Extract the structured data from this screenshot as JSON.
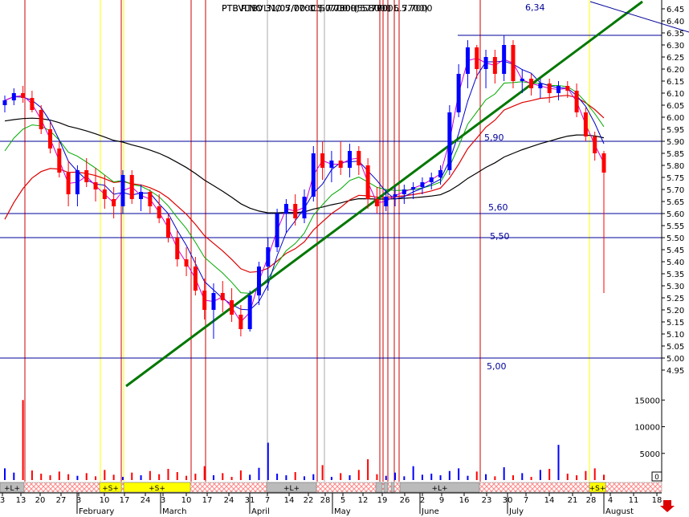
{
  "header": {
    "title": "PTBVLNO 31/07/00: C 5.7700 (5.7700, 5.7700)",
    "overprint_1": "PTBVLNO 31/07/00 C 5.7700 H 5.8000 L 5.7000",
    "overprint_2": "PTBVLNO 5.7700 (-0.0300) 5.7700"
  },
  "price_ticks": [
    "6.45",
    "6.40",
    "6.35",
    "6.30",
    "6.25",
    "6.20",
    "6.15",
    "6.10",
    "6.05",
    "6.00",
    "5.95",
    "5.90",
    "5.85",
    "5.80",
    "5.75",
    "5.70",
    "5.65",
    "5.60",
    "5.55",
    "5.50",
    "5.45",
    "5.40",
    "5.35",
    "5.30",
    "5.25",
    "5.20",
    "5.15",
    "5.10",
    "5.05",
    "5.00",
    "4.95"
  ],
  "volume_ticks": [
    "15000",
    "10000",
    "5000"
  ],
  "volume_zero_box": "0",
  "level_labels": [
    "6,34",
    "5,90",
    "5,60",
    "5,50",
    "5,00"
  ],
  "date_ticks": [
    "3",
    "13",
    "20",
    "27",
    "3",
    "10",
    "17",
    "24",
    "3",
    "10",
    "17",
    "24",
    "31",
    "7",
    "14",
    "22",
    "28",
    "5",
    "12",
    "19",
    "26",
    "2",
    "9",
    "16",
    "23",
    "30",
    "7",
    "14",
    "21",
    "28",
    "4",
    "11",
    "18"
  ],
  "month_labels": [
    "February",
    "March",
    "April",
    "May",
    "June",
    "July",
    "August"
  ],
  "signals": [
    "+L+",
    "+S+",
    "+S+",
    "+L+",
    "+L+",
    "+S+"
  ],
  "down_arrow": "down-arrow",
  "colors": {
    "up_candle": "#0000ff",
    "down_candle": "#ff0000",
    "ma_fast": "#0000cc",
    "ma_medium": "#00aa00",
    "ma_slow": "#dd0000",
    "ma_long": "#000000",
    "ma_magenta": "#cc00cc",
    "trendline": "#007700",
    "level_line": "#000099",
    "cycle_red": "#cc0000",
    "cycle_yellow": "#ffff00",
    "signal_long": "#bbbbbb",
    "signal_short": "#ffff00",
    "signal_hatch": "#ff8888"
  },
  "chart_data": {
    "type": "candlestick",
    "title": "PTBVLNO",
    "y_range": [
      4.95,
      6.45
    ],
    "volume_range": [
      0,
      17000
    ],
    "levels": [
      6.34,
      5.9,
      5.6,
      5.5,
      5.0
    ],
    "candles": [
      {
        "i": 0,
        "o": 6.05,
        "h": 6.09,
        "l": 6.02,
        "c": 6.07
      },
      {
        "i": 1,
        "o": 6.07,
        "h": 6.12,
        "l": 6.05,
        "c": 6.1
      },
      {
        "i": 2,
        "o": 6.1,
        "h": 6.13,
        "l": 6.06,
        "c": 6.08
      },
      {
        "i": 3,
        "o": 6.08,
        "h": 6.11,
        "l": 6.02,
        "c": 6.03
      },
      {
        "i": 4,
        "o": 6.03,
        "h": 6.05,
        "l": 5.93,
        "c": 5.95
      },
      {
        "i": 5,
        "o": 5.95,
        "h": 5.98,
        "l": 5.85,
        "c": 5.87
      },
      {
        "i": 6,
        "o": 5.87,
        "h": 5.9,
        "l": 5.75,
        "c": 5.77
      },
      {
        "i": 7,
        "o": 5.77,
        "h": 5.82,
        "l": 5.63,
        "c": 5.68
      },
      {
        "i": 8,
        "o": 5.68,
        "h": 5.8,
        "l": 5.63,
        "c": 5.78
      },
      {
        "i": 9,
        "o": 5.78,
        "h": 5.83,
        "l": 5.71,
        "c": 5.73
      },
      {
        "i": 10,
        "o": 5.73,
        "h": 5.79,
        "l": 5.65,
        "c": 5.7
      },
      {
        "i": 11,
        "o": 5.7,
        "h": 5.76,
        "l": 5.62,
        "c": 5.66
      },
      {
        "i": 12,
        "o": 5.66,
        "h": 5.71,
        "l": 5.58,
        "c": 5.63
      },
      {
        "i": 13,
        "o": 5.63,
        "h": 5.78,
        "l": 5.6,
        "c": 5.76
      },
      {
        "i": 14,
        "o": 5.76,
        "h": 5.78,
        "l": 5.64,
        "c": 5.66
      },
      {
        "i": 15,
        "o": 5.66,
        "h": 5.72,
        "l": 5.61,
        "c": 5.69
      },
      {
        "i": 16,
        "o": 5.69,
        "h": 5.7,
        "l": 5.6,
        "c": 5.63
      },
      {
        "i": 17,
        "o": 5.63,
        "h": 5.68,
        "l": 5.56,
        "c": 5.58
      },
      {
        "i": 18,
        "o": 5.58,
        "h": 5.6,
        "l": 5.48,
        "c": 5.5
      },
      {
        "i": 19,
        "o": 5.5,
        "h": 5.53,
        "l": 5.38,
        "c": 5.41
      },
      {
        "i": 20,
        "o": 5.41,
        "h": 5.46,
        "l": 5.34,
        "c": 5.38
      },
      {
        "i": 21,
        "o": 5.38,
        "h": 5.42,
        "l": 5.26,
        "c": 5.28
      },
      {
        "i": 22,
        "o": 5.28,
        "h": 5.33,
        "l": 5.16,
        "c": 5.2
      },
      {
        "i": 23,
        "o": 5.2,
        "h": 5.31,
        "l": 5.08,
        "c": 5.27
      },
      {
        "i": 24,
        "o": 5.27,
        "h": 5.32,
        "l": 5.19,
        "c": 5.24
      },
      {
        "i": 25,
        "o": 5.24,
        "h": 5.29,
        "l": 5.15,
        "c": 5.18
      },
      {
        "i": 26,
        "o": 5.18,
        "h": 5.22,
        "l": 5.09,
        "c": 5.12
      },
      {
        "i": 27,
        "o": 5.12,
        "h": 5.28,
        "l": 5.11,
        "c": 5.26
      },
      {
        "i": 28,
        "o": 5.26,
        "h": 5.4,
        "l": 5.22,
        "c": 5.38
      },
      {
        "i": 29,
        "o": 5.38,
        "h": 5.5,
        "l": 5.28,
        "c": 5.46
      },
      {
        "i": 30,
        "o": 5.46,
        "h": 5.62,
        "l": 5.44,
        "c": 5.6
      },
      {
        "i": 31,
        "o": 5.6,
        "h": 5.66,
        "l": 5.52,
        "c": 5.64
      },
      {
        "i": 32,
        "o": 5.64,
        "h": 5.68,
        "l": 5.55,
        "c": 5.58
      },
      {
        "i": 33,
        "o": 5.58,
        "h": 5.7,
        "l": 5.56,
        "c": 5.67
      },
      {
        "i": 34,
        "o": 5.67,
        "h": 5.88,
        "l": 5.65,
        "c": 5.85
      },
      {
        "i": 35,
        "o": 5.85,
        "h": 5.9,
        "l": 5.74,
        "c": 5.79
      },
      {
        "i": 36,
        "o": 5.79,
        "h": 5.86,
        "l": 5.73,
        "c": 5.82
      },
      {
        "i": 37,
        "o": 5.82,
        "h": 5.9,
        "l": 5.76,
        "c": 5.79
      },
      {
        "i": 38,
        "o": 5.79,
        "h": 5.89,
        "l": 5.75,
        "c": 5.86
      },
      {
        "i": 39,
        "o": 5.86,
        "h": 5.88,
        "l": 5.76,
        "c": 5.8
      },
      {
        "i": 40,
        "o": 5.8,
        "h": 5.83,
        "l": 5.62,
        "c": 5.66
      },
      {
        "i": 41,
        "o": 5.66,
        "h": 5.71,
        "l": 5.6,
        "c": 5.63
      },
      {
        "i": 42,
        "o": 5.63,
        "h": 5.7,
        "l": 5.61,
        "c": 5.67
      },
      {
        "i": 43,
        "o": 5.67,
        "h": 5.71,
        "l": 5.63,
        "c": 5.68
      },
      {
        "i": 44,
        "o": 5.68,
        "h": 5.72,
        "l": 5.64,
        "c": 5.7
      },
      {
        "i": 45,
        "o": 5.7,
        "h": 5.73,
        "l": 5.66,
        "c": 5.71
      },
      {
        "i": 46,
        "o": 5.71,
        "h": 5.75,
        "l": 5.68,
        "c": 5.73
      },
      {
        "i": 47,
        "o": 5.73,
        "h": 5.77,
        "l": 5.7,
        "c": 5.75
      },
      {
        "i": 48,
        "o": 5.75,
        "h": 5.8,
        "l": 5.72,
        "c": 5.78
      },
      {
        "i": 49,
        "o": 5.78,
        "h": 6.05,
        "l": 5.76,
        "c": 6.02
      },
      {
        "i": 50,
        "o": 6.02,
        "h": 6.22,
        "l": 6.0,
        "c": 6.18
      },
      {
        "i": 51,
        "o": 6.18,
        "h": 6.32,
        "l": 6.12,
        "c": 6.29
      },
      {
        "i": 52,
        "o": 6.29,
        "h": 6.3,
        "l": 6.16,
        "c": 6.2
      },
      {
        "i": 53,
        "o": 6.2,
        "h": 6.28,
        "l": 6.12,
        "c": 6.25
      },
      {
        "i": 54,
        "o": 6.25,
        "h": 6.28,
        "l": 6.14,
        "c": 6.18
      },
      {
        "i": 55,
        "o": 6.18,
        "h": 6.34,
        "l": 6.15,
        "c": 6.3
      },
      {
        "i": 56,
        "o": 6.3,
        "h": 6.32,
        "l": 6.12,
        "c": 6.15
      },
      {
        "i": 57,
        "o": 6.15,
        "h": 6.2,
        "l": 6.1,
        "c": 6.16
      },
      {
        "i": 58,
        "o": 6.16,
        "h": 6.18,
        "l": 6.09,
        "c": 6.12
      },
      {
        "i": 59,
        "o": 6.12,
        "h": 6.16,
        "l": 6.08,
        "c": 6.14
      },
      {
        "i": 60,
        "o": 6.14,
        "h": 6.16,
        "l": 6.06,
        "c": 6.1
      },
      {
        "i": 61,
        "o": 6.1,
        "h": 6.15,
        "l": 6.07,
        "c": 6.13
      },
      {
        "i": 62,
        "o": 6.13,
        "h": 6.15,
        "l": 6.08,
        "c": 6.11
      },
      {
        "i": 63,
        "o": 6.11,
        "h": 6.14,
        "l": 6.0,
        "c": 6.02
      },
      {
        "i": 64,
        "o": 6.02,
        "h": 6.04,
        "l": 5.9,
        "c": 5.92
      },
      {
        "i": 65,
        "o": 5.92,
        "h": 5.94,
        "l": 5.82,
        "c": 5.85
      },
      {
        "i": 66,
        "o": 5.85,
        "h": 5.86,
        "l": 5.27,
        "c": 5.77
      }
    ],
    "volume": [
      2200,
      1400,
      15000,
      1800,
      1200,
      900,
      1600,
      1100,
      800,
      1300,
      700,
      1900,
      1000,
      600,
      1400,
      900,
      1700,
      1100,
      2100,
      1500,
      800,
      1200,
      2600,
      900,
      1300,
      600,
      1800,
      1000,
      2300,
      7000,
      1200,
      900,
      1500,
      700,
      1100,
      2800,
      600,
      1300,
      900,
      1900,
      3900,
      1100,
      800,
      1400,
      700,
      2600,
      1000,
      1200,
      900,
      1700,
      2200,
      800,
      1600,
      1100,
      700,
      2400,
      900,
      1300,
      600,
      1900,
      2100,
      6600,
      1200,
      900,
      1700,
      2200,
      1000
    ]
  }
}
